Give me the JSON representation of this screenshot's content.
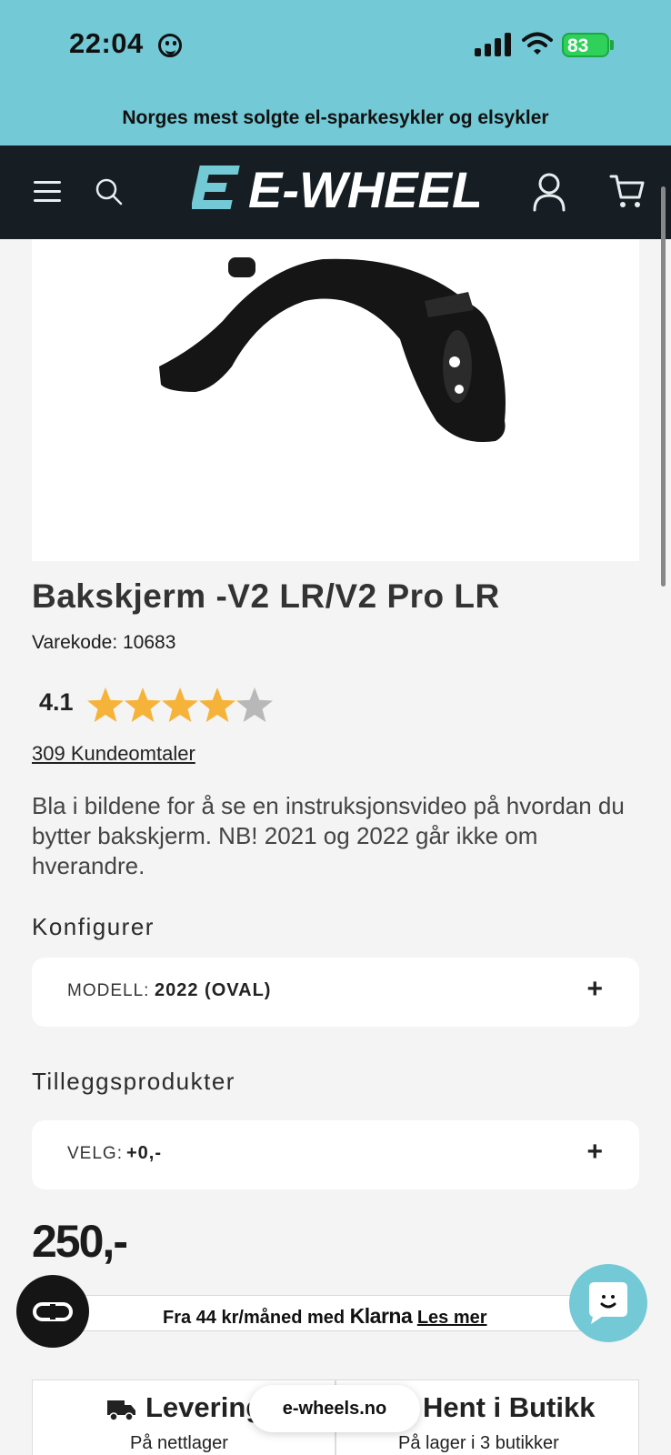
{
  "status_bar": {
    "time": "22:04",
    "battery": "83"
  },
  "promo_banner": {
    "text": "Norges mest solgte el-sparkesykler og elsykler"
  },
  "header": {
    "logo_text": "E-WHEELS"
  },
  "product": {
    "title": "Bakskjerm -V2 LR/V2 Pro LR",
    "sku": "Varekode: 10683",
    "rating": "4.1",
    "rating_value": 4.1,
    "rating_max": 5,
    "reviews": "309 Kundeomtaler",
    "description": "Bla i bildene for å se en instruksjonsvideo på hvordan du bytter bakskjerm. NB! 2021 og 2022 går ikke om hverandre."
  },
  "configure": {
    "heading": "Konfigurer",
    "option_label": "MODELL:",
    "option_value": "2022 (OVAL)",
    "expand": "+"
  },
  "addons": {
    "heading": "Tilleggsprodukter",
    "option_label": "VELG:",
    "option_value": "+0,-",
    "expand": "+"
  },
  "price": "250,-",
  "klarna": {
    "prefix": "Fra 44 kr/måned med",
    "brand": "Klarna",
    "link": "Les mer"
  },
  "delivery": {
    "shipping_title": "Levering",
    "shipping_sub": "På nettlager",
    "pickup_title": "Hent i Butikk",
    "pickup_sub": "På lager i 3 butikker"
  },
  "browser": {
    "url": "e-wheels.no"
  },
  "colors": {
    "accent": "#73c9d6",
    "header_bg": "#161e23",
    "star": "#f6b33a"
  }
}
